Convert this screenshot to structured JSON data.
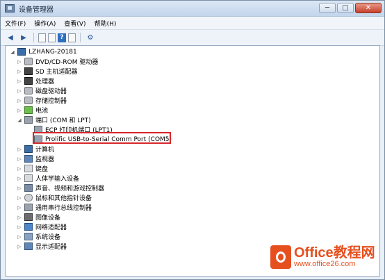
{
  "window": {
    "title": "设备管理器"
  },
  "title_buttons": [
    "─",
    "□",
    "✕"
  ],
  "menu": [
    "文件(F)",
    "操作(A)",
    "查看(V)",
    "帮助(H)"
  ],
  "tree": {
    "root": "LZHANG-20181",
    "items": [
      {
        "label": "DVD/CD-ROM 驱动器",
        "icon": "drive-icon",
        "expanded": false
      },
      {
        "label": "SD 主机适配器",
        "icon": "chip-icon",
        "expanded": false
      },
      {
        "label": "处理器",
        "icon": "chip-icon",
        "expanded": false
      },
      {
        "label": "磁盘驱动器",
        "icon": "drive-icon",
        "expanded": false
      },
      {
        "label": "存储控制器",
        "icon": "drive-icon",
        "expanded": false
      },
      {
        "label": "电池",
        "icon": "battery-icon",
        "expanded": false
      },
      {
        "label": "端口 (COM 和 LPT)",
        "icon": "port-icon",
        "expanded": true
      },
      {
        "label": "ECP 打印机端口 (LPT1)",
        "icon": "port-icon",
        "child": true
      },
      {
        "label": "Prolific USB-to-Serial Comm Port (COM5)",
        "icon": "port-icon",
        "child": true,
        "highlighted": true
      },
      {
        "label": "计算机",
        "icon": "computer-icon",
        "expanded": false
      },
      {
        "label": "监视器",
        "icon": "monitor-icon",
        "expanded": false
      },
      {
        "label": "键盘",
        "icon": "keyboard-icon",
        "expanded": false
      },
      {
        "label": "人体学输入设备",
        "icon": "hid-icon",
        "expanded": false
      },
      {
        "label": "声音、视频和游戏控制器",
        "icon": "sound-icon",
        "expanded": false
      },
      {
        "label": "鼠标和其他指针设备",
        "icon": "mouse-icon",
        "expanded": false
      },
      {
        "label": "通用串行总线控制器",
        "icon": "usb-icon",
        "expanded": false
      },
      {
        "label": "图像设备",
        "icon": "camera-icon",
        "expanded": false
      },
      {
        "label": "网络适配器",
        "icon": "network-icon",
        "expanded": false
      },
      {
        "label": "系统设备",
        "icon": "system-icon",
        "expanded": false
      },
      {
        "label": "显示适配器",
        "icon": "display-icon",
        "expanded": false
      }
    ]
  },
  "watermark": {
    "main": "Office教程网",
    "sub": "www.office26.com"
  },
  "colors": {
    "highlight": "#d7272b",
    "watermark": "#e6501f"
  }
}
